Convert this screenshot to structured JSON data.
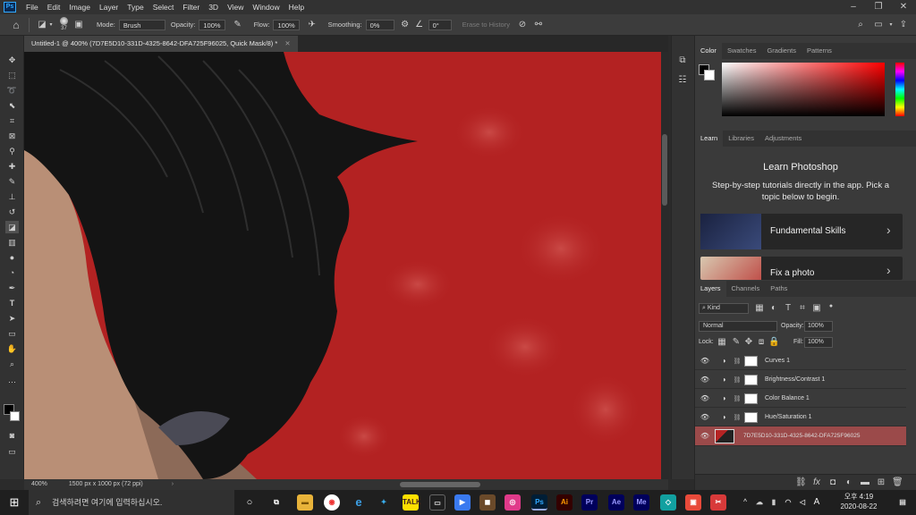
{
  "app": {
    "logo": "Ps",
    "menu": [
      "File",
      "Edit",
      "Image",
      "Layer",
      "Type",
      "Select",
      "Filter",
      "3D",
      "View",
      "Window",
      "Help"
    ]
  },
  "options": {
    "brush_size": "37",
    "mode_label": "Mode:",
    "mode_value": "Brush",
    "opacity_label": "Opacity:",
    "opacity_value": "100%",
    "flow_label": "Flow:",
    "flow_value": "100%",
    "smoothing_label": "Smoothing:",
    "smoothing_value": "0%",
    "angle_value": "0°",
    "erase_history": "Erase to History"
  },
  "document": {
    "tab_title": "Untitled-1 @ 400% (7D7E5D10-331D-4325-8642-DFA725F96025, Quick Mask/8) *",
    "zoom": "400%",
    "size_info": "1500 px x 1000 px (72 ppi)"
  },
  "color_panel": {
    "tabs": [
      "Color",
      "Swatches",
      "Gradients",
      "Patterns"
    ],
    "active": "Color"
  },
  "learn_panel": {
    "tabs": [
      "Learn",
      "Libraries",
      "Adjustments"
    ],
    "title": "Learn Photoshop",
    "subtitle": "Step-by-step tutorials directly in the app. Pick a topic below to begin.",
    "cards": [
      "Fundamental Skills",
      "Fix a photo"
    ]
  },
  "layers_panel": {
    "tabs": [
      "Layers",
      "Channels",
      "Paths"
    ],
    "kind_label": "Kind",
    "blend_mode": "Normal",
    "opacity_label": "Opacity:",
    "opacity_value": "100%",
    "lock_label": "Lock:",
    "fill_label": "Fill:",
    "fill_value": "100%",
    "layers": [
      {
        "name": "Curves 1"
      },
      {
        "name": "Brightness/Contrast 1"
      },
      {
        "name": "Color Balance 1"
      },
      {
        "name": "Hue/Saturation 1"
      },
      {
        "name": "7D7E5D10-331D-4325-8642-DFA725F96025"
      }
    ]
  },
  "taskbar": {
    "search_placeholder": "검색하려면 여기에 입력하십시오.",
    "time": "오후 4:19",
    "date": "2020-08-22",
    "ime": "A",
    "apps": [
      "Ai",
      "Pr",
      "Ae",
      "Me"
    ]
  },
  "colors": {
    "quickmask_red": "#b52424",
    "selected_layer": "#9b4a4a",
    "accent_blue": "#31a8ff"
  }
}
